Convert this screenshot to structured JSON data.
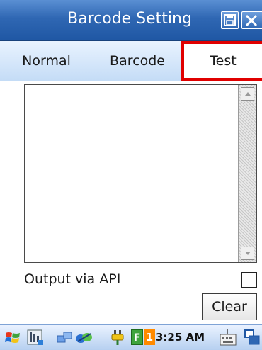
{
  "window": {
    "title": "Barcode Setting"
  },
  "tabs": [
    {
      "label": "Normal"
    },
    {
      "label": "Barcode"
    },
    {
      "label": "Test"
    }
  ],
  "output": {
    "value": ""
  },
  "options": {
    "output_via_api_label": "Output via API",
    "output_via_api_checked": false
  },
  "actions": {
    "clear_label": "Clear"
  },
  "taskbar": {
    "time": "3:25 AM",
    "f_badge": "F",
    "num_badge": "1"
  },
  "colors": {
    "accent": "#2f67b3",
    "highlight": "#e00000"
  },
  "icons": [
    "save-icon",
    "close-icon",
    "start-icon",
    "keyboard-icon"
  ]
}
